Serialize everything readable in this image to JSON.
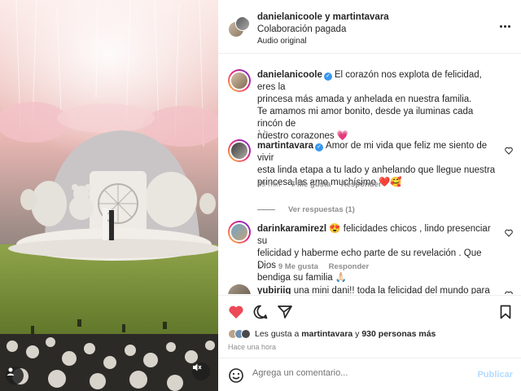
{
  "colors": {
    "accent": "#0095f6",
    "verified": "#3897f0",
    "liked": "#ed4956",
    "muted_text": "#8e8e8e"
  },
  "media": {
    "user_icon": "person-icon",
    "mute_icon": "speaker-muted-icon"
  },
  "header": {
    "title": "danielanicoole y martintavara",
    "subtitle": "Colaboración pagada",
    "audio": "Audio original",
    "more_icon": "more-horizontal-icon"
  },
  "comments": [
    {
      "user": "danielanicoole",
      "verified": true,
      "text_lines": [
        "El corazón nos explota de felicidad, eres la",
        "princesa más amada y anhelada en nuestra familia.",
        "Te amamos mi amor bonito, desde ya iluminas cada rincón de",
        "nuestro corazones"
      ],
      "emoji": "💗",
      "time": "1 h"
    },
    {
      "user": "martintavara",
      "verified": true,
      "text_lines": [
        "Amor de mi vida que feliz me siento de vivir",
        "esta linda etapa a tu lado y anhelando que llegue nuestra",
        "princesa,las amo muchísimo"
      ],
      "emoji": "❤️🥰",
      "time": "49 min",
      "likes": "7 Me gusta",
      "reply": "Responder",
      "view_replies": "Ver respuestas (1)"
    },
    {
      "user": "darinkaramirezl",
      "verified": false,
      "emoji_lead": "😍",
      "text_lines": [
        "felicidades chicos , lindo presenciar su",
        "felicidad y haberme echo parte de su revelación . Que Dios",
        "bendiga su familia"
      ],
      "emoji": "🙏🏻",
      "time": "1 h",
      "likes": "9 Me gusta",
      "reply": "Responder"
    },
    {
      "user": "yubiriig",
      "verified": false,
      "text_lines": [
        "una mini dani!! toda la felicidad del mundo para"
      ]
    }
  ],
  "actions": {
    "like_icon": "heart-filled-icon",
    "comment_icon": "comment-icon",
    "share_icon": "send-icon",
    "save_icon": "bookmark-icon"
  },
  "likes": {
    "prefix": "Les gusta a",
    "user": "martintavara",
    "joiner": "y",
    "others": "930 personas más"
  },
  "time_ago": "Hace una hora",
  "add_comment": {
    "placeholder": "Agrega un comentario...",
    "publish": "Publicar",
    "emoji_icon": "smiley-icon"
  }
}
